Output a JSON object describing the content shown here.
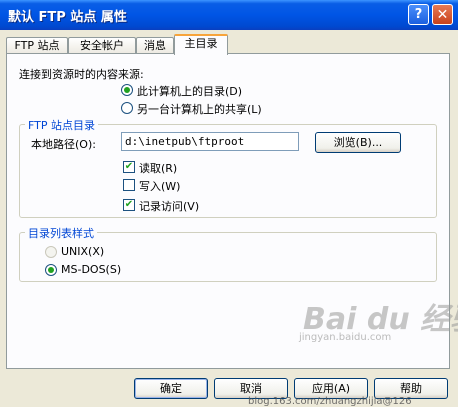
{
  "window": {
    "title": "默认 FTP 站点 属性",
    "help_button": "?",
    "close_button": "✕"
  },
  "tabs": [
    {
      "label": "FTP 站点"
    },
    {
      "label": "安全帐户"
    },
    {
      "label": "消息"
    },
    {
      "label": "主目录",
      "active": true
    }
  ],
  "content_source": {
    "label": "连接到资源时的内容来源:",
    "options": [
      {
        "label": "此计算机上的目录(D)",
        "checked": true
      },
      {
        "label": "另一台计算机上的共享(L)",
        "checked": false
      }
    ]
  },
  "ftp_dir": {
    "group_title": "FTP 站点目录",
    "local_path_label": "本地路径(O):",
    "local_path_value": "d:\\inetpub\\ftproot",
    "browse_button": "浏览(B)...",
    "checkboxes": [
      {
        "label": "读取(R)",
        "checked": true
      },
      {
        "label": "写入(W)",
        "checked": false
      },
      {
        "label": "记录访问(V)",
        "checked": true
      }
    ]
  },
  "listing_style": {
    "group_title": "目录列表样式",
    "options": [
      {
        "label": "UNIX(X)",
        "checked": false,
        "disabled": true
      },
      {
        "label": "MS-DOS(S)",
        "checked": true
      }
    ]
  },
  "footer": {
    "ok": "确定",
    "cancel": "取消",
    "apply": "应用(A)",
    "help": "帮助"
  },
  "watermarks": {
    "site": "jingyan.baidu.com",
    "blog": "blog.163.com/zhuangzhijia@126",
    "logo_text": "Bai du 经验"
  },
  "colors": {
    "titlebar": "#0055e5",
    "dialog_bg": "#ece9d8",
    "group_title": "#0046d5",
    "check_mark": "#21a121"
  }
}
